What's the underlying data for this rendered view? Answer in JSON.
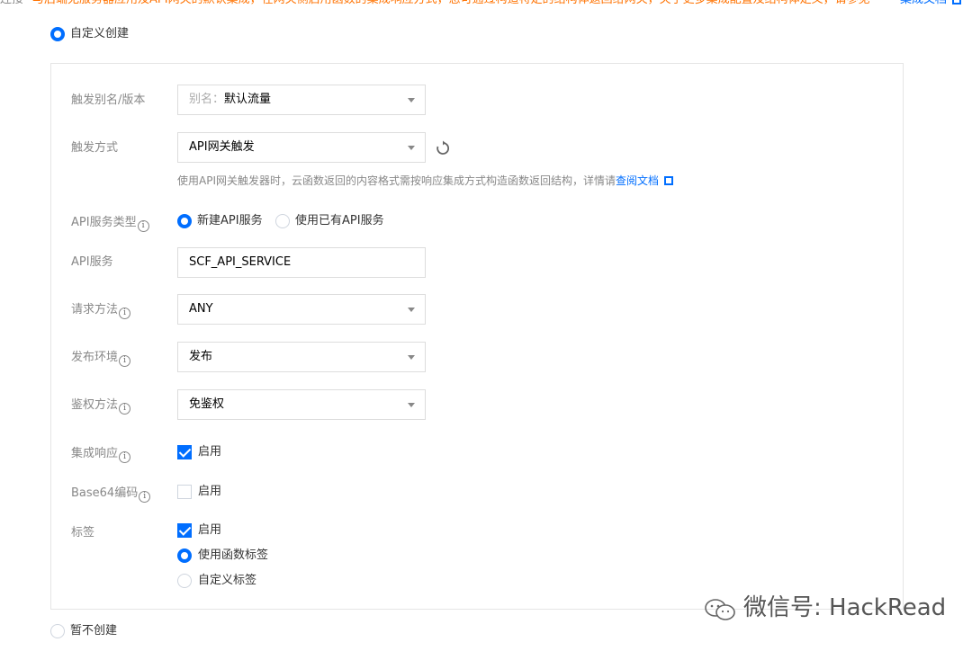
{
  "top_notice": {
    "lead": "连接",
    "text": "与后端无服务器应用及API网关的默认集成，在网关侧启用函数的集成响应方式，您可通过构造特定的结构体返回给网关，关于更多集成配置及结构体定义，请参见",
    "link": "集成文档"
  },
  "create_mode": {
    "custom_label": "自定义创建",
    "none_label": "暂不创建"
  },
  "form": {
    "alias": {
      "label": "触发别名/版本",
      "prefix": "别名：",
      "value": "默认流量"
    },
    "trigger": {
      "label": "触发方式",
      "value": "API网关触发",
      "hint": "使用API网关触发器时，云函数返回的内容格式需按响应集成方式构造函数返回结构，详情请",
      "hint_link": "查阅文档"
    },
    "api_service_type": {
      "label": "API服务类型",
      "option_new": "新建API服务",
      "option_existing": "使用已有API服务"
    },
    "api_service": {
      "label": "API服务",
      "value": "SCF_API_SERVICE"
    },
    "request_method": {
      "label": "请求方法",
      "value": "ANY"
    },
    "environment": {
      "label": "发布环境",
      "value": "发布"
    },
    "auth": {
      "label": "鉴权方法",
      "value": "免鉴权"
    },
    "integration_response": {
      "label": "集成响应",
      "option": "启用",
      "checked": true
    },
    "base64": {
      "label": "Base64编码",
      "option": "启用",
      "checked": false
    },
    "tags": {
      "label": "标签",
      "option": "启用",
      "checked": true,
      "use_function_tags": "使用函数标签",
      "custom_tags": "自定义标签"
    }
  },
  "info_glyph": "i",
  "watermark": {
    "text": "微信号: HackRead"
  },
  "colors": {
    "accent": "#006eff",
    "warning": "#ff7200",
    "label": "#888888"
  }
}
